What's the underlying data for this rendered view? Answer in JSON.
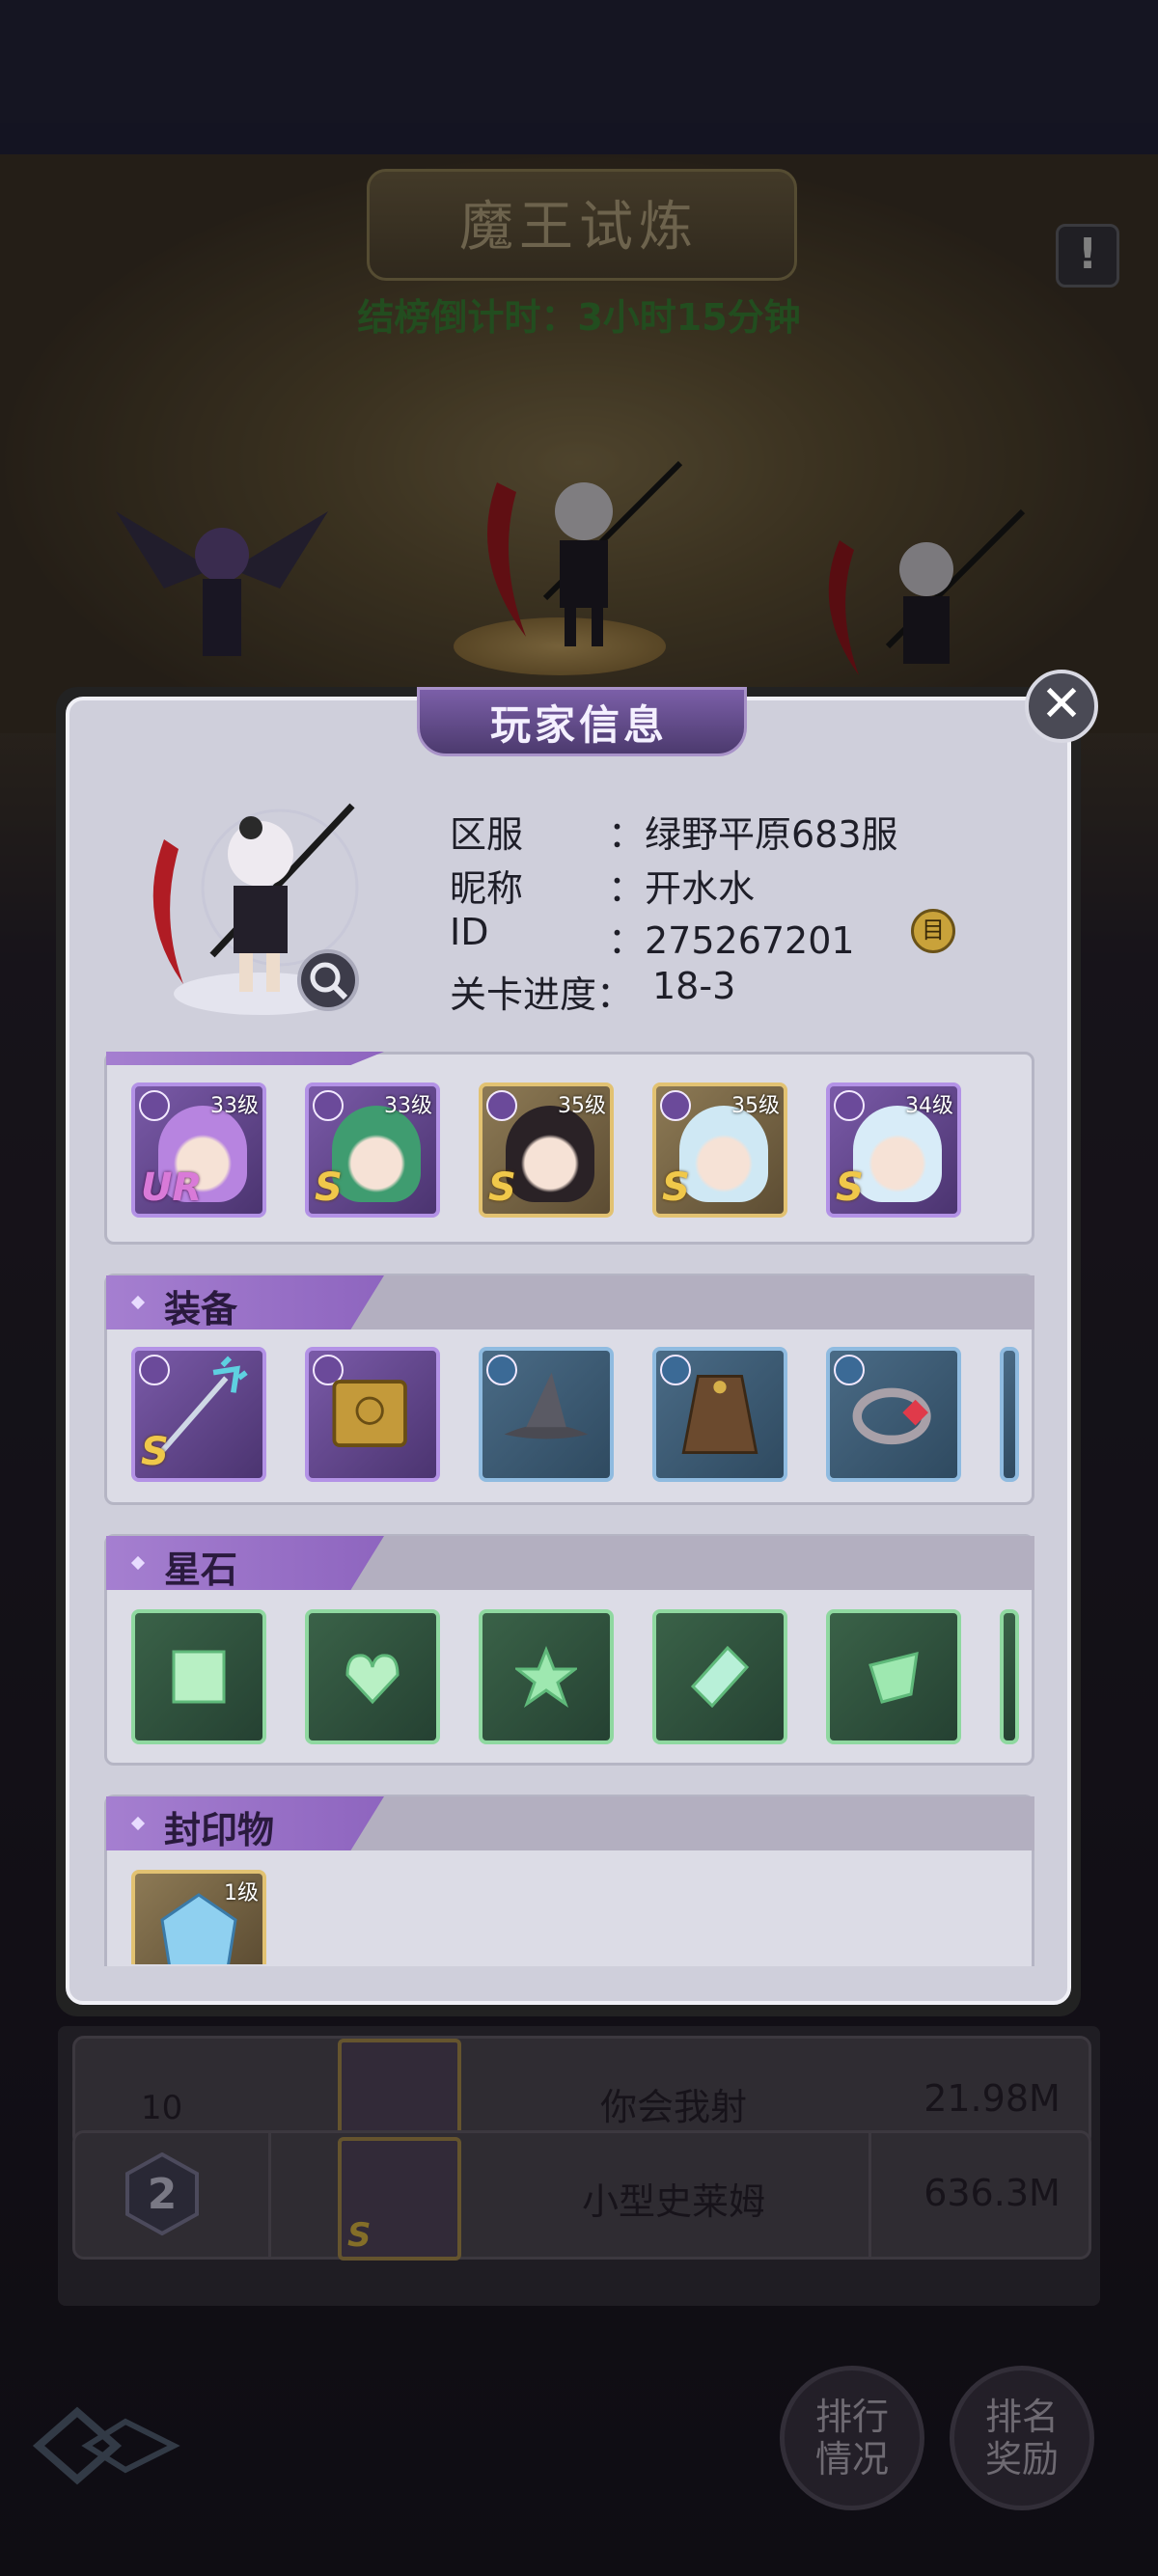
{
  "background": {
    "event_title": "魔王试炼",
    "countdown": "结榜倒计时：3小时15分钟",
    "alert_glyph": "!",
    "ranking_rows": [
      {
        "rank": "10",
        "name": "你会我射",
        "score": "21.98M"
      },
      {
        "rank": "2",
        "name": "小型史莱姆",
        "score": "636.3M",
        "portrait_rank": "S"
      }
    ],
    "nav_buttons": [
      {
        "label": "排行情况"
      },
      {
        "label": "排名奖励"
      }
    ]
  },
  "modal": {
    "title": "玩家信息",
    "close_glyph": "✕",
    "info": {
      "server_label": "区服",
      "server_value": "：绿野平原683服",
      "nickname_label": "昵称",
      "nickname_value": "：开水水",
      "id_label": "ID",
      "id_value": "：275267201",
      "progress_label": "关卡进度：",
      "progress_value": "18-3",
      "copy_glyph": "目"
    },
    "heroes": [
      {
        "level": "33级",
        "rank": "UR",
        "style": "purple",
        "hair": "#b784e0"
      },
      {
        "level": "33级",
        "rank": "S",
        "style": "purple",
        "hair": "#3f9c70"
      },
      {
        "level": "35级",
        "rank": "S",
        "style": "gold",
        "hair": "#2a2226"
      },
      {
        "level": "35级",
        "rank": "S",
        "style": "gold",
        "hair": "#cfe8f4"
      },
      {
        "level": "34级",
        "rank": "S",
        "style": "purple",
        "hair": "#d8ecf8"
      }
    ],
    "equipment": {
      "header": "装备",
      "items": [
        {
          "name": "trident-staff-icon",
          "rank": "S",
          "style": "purple"
        },
        {
          "name": "golden-book-icon",
          "rank": "",
          "style": "purple"
        },
        {
          "name": "wizard-hat-icon",
          "rank": "",
          "style": "blue"
        },
        {
          "name": "cloak-icon",
          "rank": "",
          "style": "blue"
        },
        {
          "name": "ruby-ring-icon",
          "rank": "",
          "style": "blue"
        }
      ]
    },
    "star_stones": {
      "header": "星石",
      "items": [
        {
          "name": "square-gem-icon"
        },
        {
          "name": "heart-gem-icon"
        },
        {
          "name": "star-gem-icon"
        },
        {
          "name": "diamond-gem-icon"
        },
        {
          "name": "shield-gem-icon"
        }
      ]
    },
    "seals": {
      "header": "封印物",
      "items": [
        {
          "name": "ice-crystal-icon",
          "level": "1级"
        }
      ]
    }
  },
  "colors": {
    "accent_purple": "#8e65bf",
    "countdown_green": "#3f8c3a",
    "gold_border": "#e2c272"
  }
}
